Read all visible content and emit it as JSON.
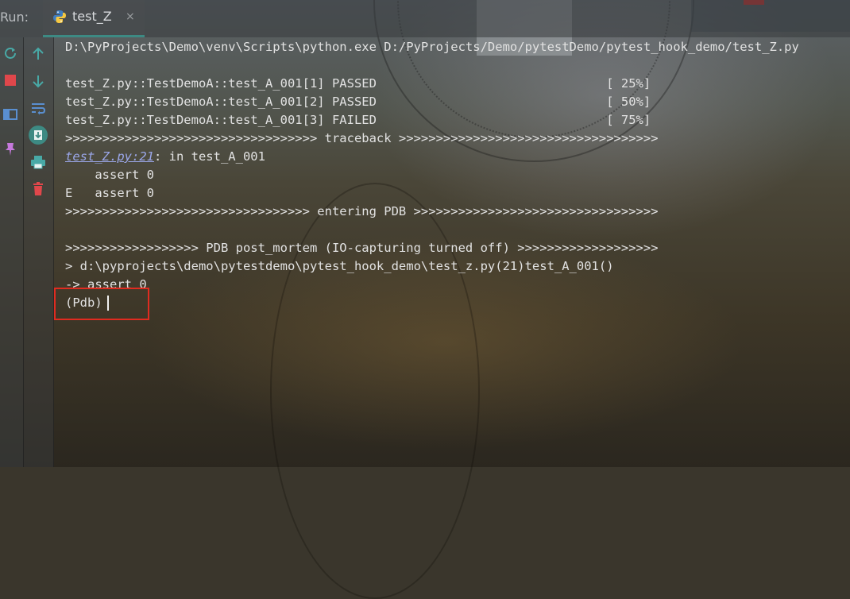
{
  "tabbar": {
    "run_label": "Run:",
    "tab_title": "test_Z",
    "close_glyph": "×",
    "tab_icon": "python-icon"
  },
  "toolbar_left": [
    {
      "icon": "rerun-icon",
      "color": "#48a9a6"
    },
    {
      "icon": "stop-icon",
      "color": "#e0474b"
    },
    {
      "icon": "layout-icon",
      "color": "#5a8fd0"
    },
    {
      "icon": "pin-icon",
      "color": "#c679dd"
    }
  ],
  "toolbar_right": [
    {
      "icon": "up-arrow-icon",
      "color": "#48a9a6"
    },
    {
      "icon": "down-arrow-icon",
      "color": "#48a9a6"
    },
    {
      "icon": "soft-wrap-icon",
      "color": "#5a8fd0"
    },
    {
      "icon": "scroll-to-end-icon",
      "color": "#48a9a6"
    },
    {
      "icon": "print-icon",
      "color": "#48a9a6"
    },
    {
      "icon": "trash-icon",
      "color": "#e0474b"
    }
  ],
  "console": {
    "command": "D:\\PyProjects\\Demo\\venv\\Scripts\\python.exe D:/PyProjects/Demo/pytestDemo/pytest_hook_demo/test_Z.py",
    "result1": "test_Z.py::TestDemoA::test_A_001[1] PASSED                               [ 25%]",
    "result2": "test_Z.py::TestDemoA::test_A_001[2] PASSED                               [ 50%]",
    "result3": "test_Z.py::TestDemoA::test_A_001[3] FAILED                               [ 75%]",
    "traceback_banner": ">>>>>>>>>>>>>>>>>>>>>>>>>>>>>>>>>> traceback >>>>>>>>>>>>>>>>>>>>>>>>>>>>>>>>>>>",
    "trace_link": "test_Z.py:21",
    "trace_rest": ": in test_A_001",
    "assert_line": "    assert 0",
    "error_line": "E   assert 0",
    "pdb_banner": ">>>>>>>>>>>>>>>>>>>>>>>>>>>>>>>>> entering PDB >>>>>>>>>>>>>>>>>>>>>>>>>>>>>>>>>",
    "postmortem_banner": ">>>>>>>>>>>>>>>>>> PDB post_mortem (IO-capturing turned off) >>>>>>>>>>>>>>>>>>>",
    "location_line": "> d:\\pyprojects\\demo\\pytestdemo\\pytest_hook_demo\\test_z.py(21)test_A_001()",
    "arrow_line": "-> assert 0",
    "prompt": "(Pdb)"
  }
}
